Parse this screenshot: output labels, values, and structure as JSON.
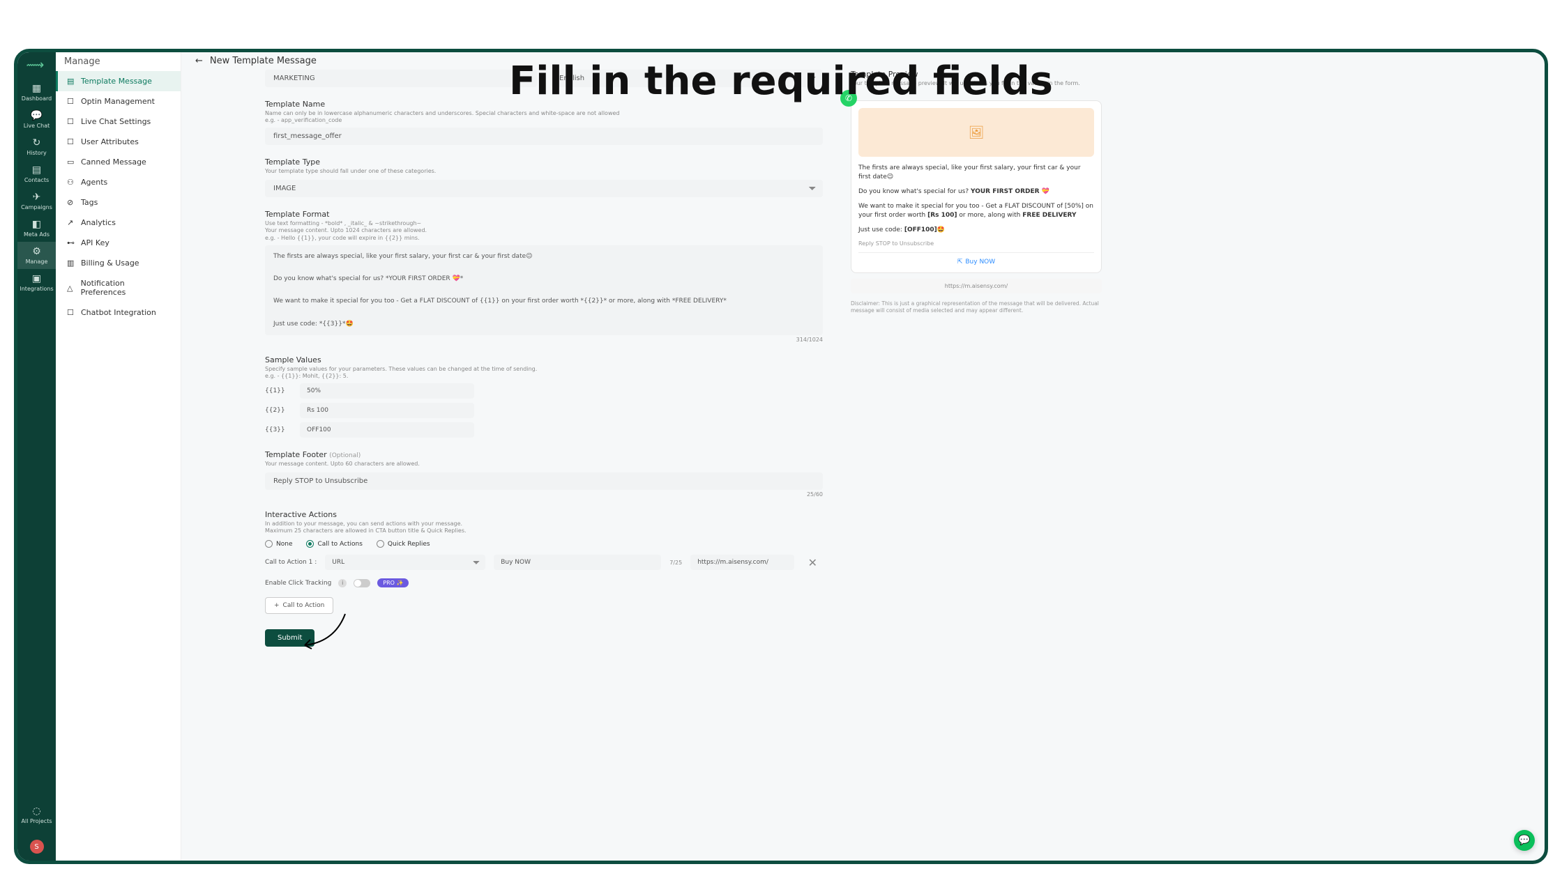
{
  "overlay_title": "Fill in the required fields",
  "rail": {
    "items": [
      {
        "icon": "▦",
        "label": "Dashboard"
      },
      {
        "icon": "💬",
        "label": "Live Chat"
      },
      {
        "icon": "↻",
        "label": "History"
      },
      {
        "icon": "▤",
        "label": "Contacts"
      },
      {
        "icon": "✈",
        "label": "Campaigns"
      },
      {
        "icon": "◧",
        "label": "Meta Ads"
      },
      {
        "icon": "⚙",
        "label": "Manage"
      },
      {
        "icon": "▣",
        "label": "Integrations"
      }
    ],
    "all_projects": "All Projects",
    "avatar_letter": "S"
  },
  "sidebar": {
    "header": "Manage",
    "items": [
      {
        "icon": "▤",
        "label": "Template Message"
      },
      {
        "icon": "☐",
        "label": "Optin Management"
      },
      {
        "icon": "☐",
        "label": "Live Chat Settings"
      },
      {
        "icon": "☐",
        "label": "User Attributes"
      },
      {
        "icon": "▭",
        "label": "Canned Message"
      },
      {
        "icon": "⚇",
        "label": "Agents"
      },
      {
        "icon": "⊘",
        "label": "Tags"
      },
      {
        "icon": "↗",
        "label": "Analytics"
      },
      {
        "icon": "⊷",
        "label": "API Key"
      },
      {
        "icon": "▥",
        "label": "Billing & Usage"
      },
      {
        "icon": "△",
        "label": "Notification Preferences"
      },
      {
        "icon": "☐",
        "label": "Chatbot Integration"
      }
    ]
  },
  "page": {
    "title": "New Template Message",
    "category_value": "MARKETING",
    "language_value": "English"
  },
  "template_name": {
    "title": "Template Name",
    "help": "Name can only be in lowercase alphanumeric characters and underscores. Special characters and white-space are not allowed",
    "help2": "e.g. - app_verification_code",
    "value": "first_message_offer"
  },
  "template_type": {
    "title": "Template Type",
    "help": "Your template type should fall under one of these categories.",
    "value": "IMAGE"
  },
  "template_format": {
    "title": "Template Format",
    "help1": "Use text formatting - *bold* , _italic_ & ~strikethrough~",
    "help2": "Your message content. Upto 1024 characters are allowed.",
    "help3": "e.g. - Hello {{1}}, your code will expire in {{2}} mins.",
    "value": "The firsts are always special, like your first salary, your first car & your first date😉\n\nDo you know what's special for us? *YOUR FIRST ORDER 💝*\n\nWe want to make it special for you too - Get a FLAT DISCOUNT of {{1}} on your first order worth *{{2}}* or more, along with *FREE DELIVERY*\n\nJust use code: *{{3}}*🤩",
    "counter": "314/1024"
  },
  "sample_values": {
    "title": "Sample Values",
    "help1": "Specify sample values for your parameters. These values can be changed at the time of sending.",
    "help2": "e.g. - {{1}}: Mohit, {{2}}: 5.",
    "rows": [
      {
        "label": "{{1}}",
        "value": "50%"
      },
      {
        "label": "{{2}}",
        "value": "Rs 100"
      },
      {
        "label": "{{3}}",
        "value": "OFF100"
      }
    ]
  },
  "footer": {
    "title": "Template Footer",
    "optional": "(Optional)",
    "help": "Your message content. Upto 60 characters are allowed.",
    "value": "Reply STOP to Unsubscribe",
    "counter": "25/60"
  },
  "interactive": {
    "title": "Interactive Actions",
    "help1": "In addition to your message, you can send actions with your message.",
    "help2": "Maximum 25 characters are allowed in CTA button title & Quick Replies.",
    "options": {
      "none": "None",
      "cta": "Call to Actions",
      "qr": "Quick Replies"
    },
    "cta1_label": "Call to Action 1 :",
    "cta1_type": "URL",
    "cta1_text": "Buy NOW",
    "cta1_counter": "7/25",
    "cta1_url": "https://m.aisensy.com/",
    "tracking_label": "Enable Click Tracking",
    "pro_label": "PRO ✨",
    "add_cta_label": "Call to Action",
    "submit_label": "Submit"
  },
  "preview": {
    "title": "Template Preview",
    "help": "Your template message preview. It will update as you fill in the values in the form.",
    "body1": "The firsts are always special, like your first salary, your first car & your first date😉",
    "body2_pre": "Do you know what's special for us? ",
    "body2_bold": "YOUR FIRST ORDER 💝",
    "body3_pre": "We want to make it special for you too - Get a FLAT DISCOUNT of [50%] on your first order worth ",
    "body3_b1": "[Rs 100]",
    "body3_mid": " or more, along with ",
    "body3_b2": "FREE DELIVERY",
    "body4_pre": "Just use code: ",
    "body4_bold": "[OFF100]",
    "body4_post": "🤩",
    "footer": "Reply STOP to Unsubscribe",
    "button": "Buy NOW",
    "url": "https://m.aisensy.com/",
    "disclaimer": "Disclaimer: This is just a graphical representation of the message that will be delivered. Actual message will consist of media selected and may appear different."
  }
}
